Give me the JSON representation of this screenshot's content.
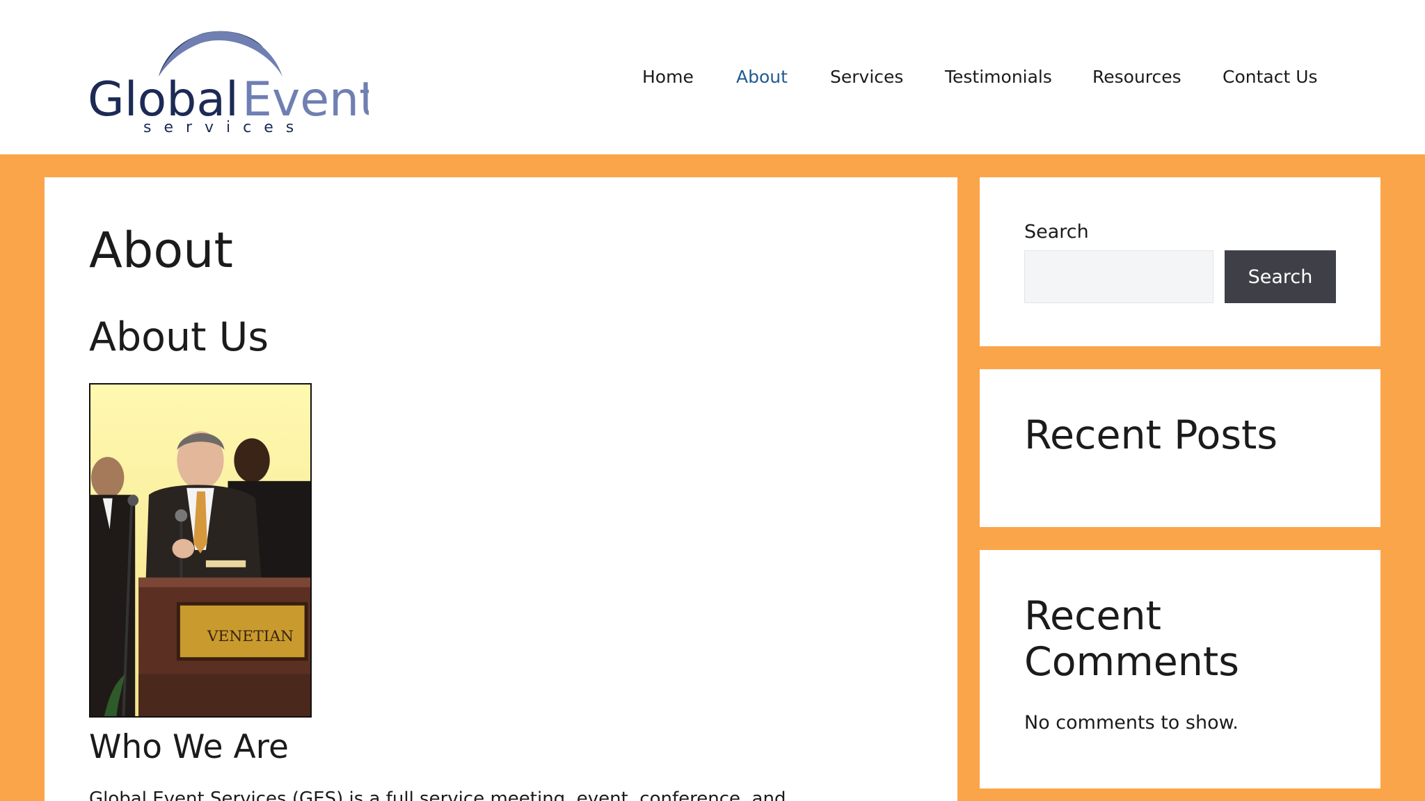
{
  "header": {
    "logo": {
      "brand_text": "GlobalEvent",
      "tagline": "services"
    },
    "nav": [
      {
        "label": "Home",
        "active": false
      },
      {
        "label": "About",
        "active": true
      },
      {
        "label": "Services",
        "active": false
      },
      {
        "label": "Testimonials",
        "active": false
      },
      {
        "label": "Resources",
        "active": false
      },
      {
        "label": "Contact Us",
        "active": false
      }
    ]
  },
  "main": {
    "page_title": "About",
    "section_title": "About Us",
    "photo_sign_text": "VENETIAN",
    "subsection_title": "Who We Are",
    "body_text": "Global Event Services (GES) is a full service meeting, event, conference, and"
  },
  "sidebar": {
    "search": {
      "label": "Search",
      "input_value": "",
      "button_label": "Search"
    },
    "recent_posts": {
      "title": "Recent Posts"
    },
    "recent_comments": {
      "title": "Recent Comments",
      "empty_text": "No comments to show."
    }
  },
  "colors": {
    "page_background": "#fba54a",
    "nav_active": "#1e5a8e",
    "logo_dark": "#1c2a55",
    "logo_light": "#6f7fb2",
    "button": "#3f4047"
  }
}
